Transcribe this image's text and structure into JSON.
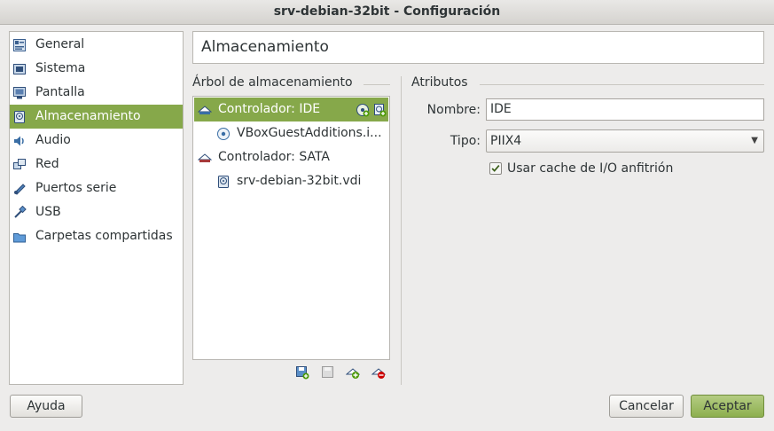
{
  "window": {
    "title": "srv-debian-32bit - Configuración"
  },
  "sidebar": {
    "items": [
      {
        "label": "General",
        "icon": "general-icon"
      },
      {
        "label": "Sistema",
        "icon": "system-icon"
      },
      {
        "label": "Pantalla",
        "icon": "display-icon"
      },
      {
        "label": "Almacenamiento",
        "icon": "storage-icon",
        "selected": true
      },
      {
        "label": "Audio",
        "icon": "audio-icon"
      },
      {
        "label": "Red",
        "icon": "network-icon"
      },
      {
        "label": "Puertos serie",
        "icon": "serial-ports-icon"
      },
      {
        "label": "USB",
        "icon": "usb-icon"
      },
      {
        "label": "Carpetas compartidas",
        "icon": "shared-folders-icon"
      }
    ]
  },
  "page": {
    "title": "Almacenamiento"
  },
  "tree": {
    "label": "Árbol de almacenamiento",
    "items": [
      {
        "label": "Controlador: IDE",
        "selected": true,
        "icon": "ide-controller-icon"
      },
      {
        "label": "VBoxGuestAdditions.i...",
        "icon": "optical-disc-icon"
      },
      {
        "label": "Controlador: SATA",
        "icon": "sata-controller-icon"
      },
      {
        "label": "srv-debian-32bit.vdi",
        "icon": "hard-disk-icon"
      }
    ]
  },
  "attributes": {
    "label": "Atributos",
    "name_label": "Nombre:",
    "name_value": "IDE",
    "type_label": "Tipo:",
    "type_value": "PIIX4",
    "cache_label": "Usar cache de I/O anfitrión",
    "cache_checked": true
  },
  "buttons": {
    "help": "Ayuda",
    "cancel": "Cancelar",
    "accept": "Aceptar"
  },
  "colors": {
    "accent": "#86a84a"
  }
}
